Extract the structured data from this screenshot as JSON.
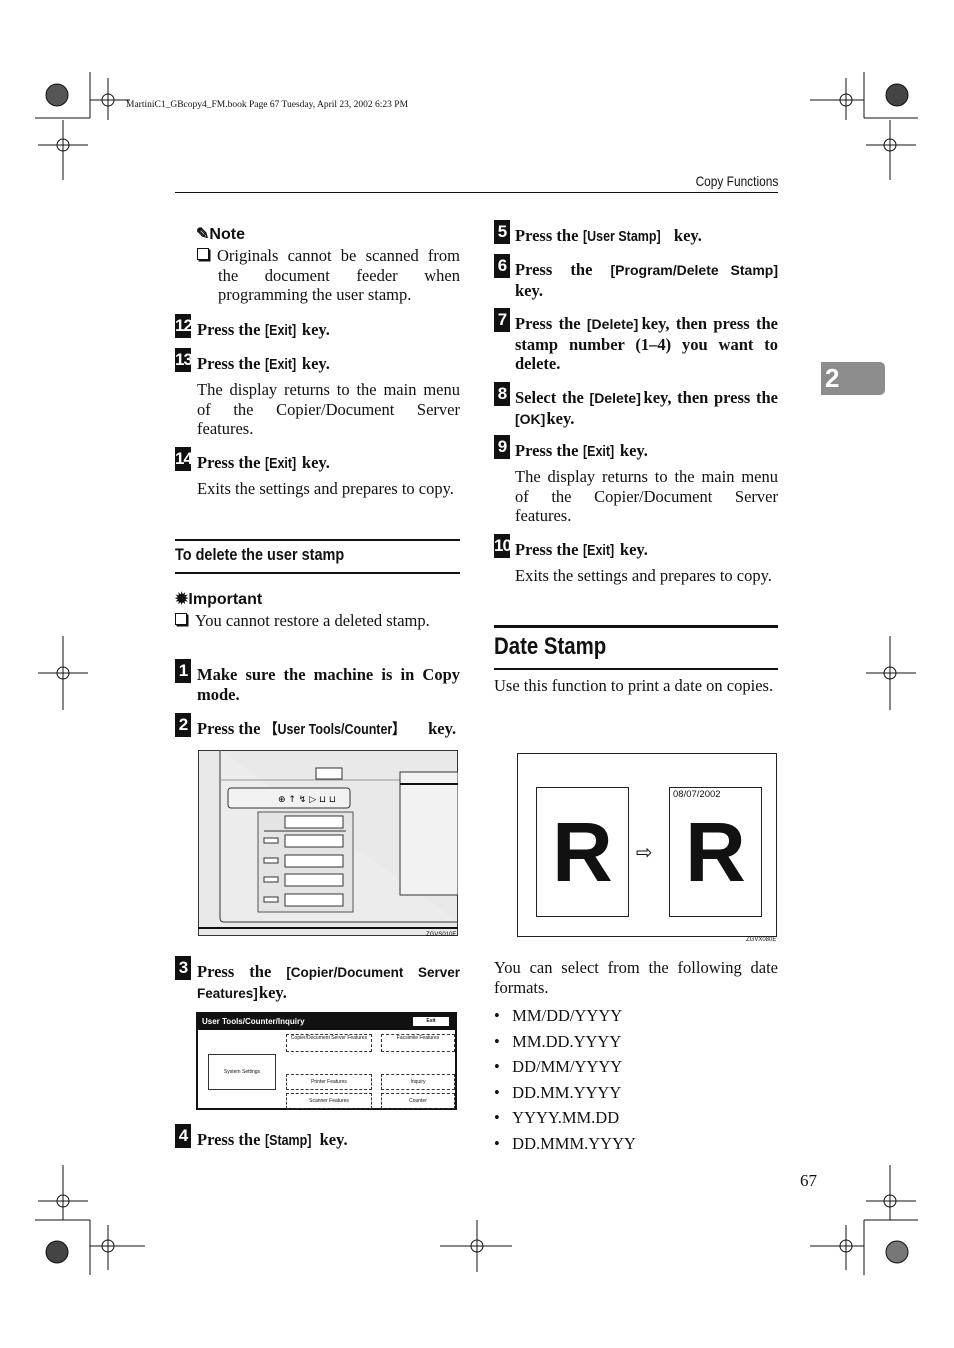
{
  "header": {
    "file_info": "MartiniC1_GBcopy4_FM.book  Page 67  Tuesday, April 23, 2002  6:23 PM",
    "section": "Copy Functions"
  },
  "chapter_tab": "2",
  "page_number": "67",
  "left": {
    "note": {
      "title": "Note",
      "text": "Originals cannot be scanned from the document feeder when programming the user stamp.",
      "icon": "pencil-icon"
    },
    "step12": {
      "num": "12",
      "pre": "Press the ",
      "key": "[Exit]",
      "post": " key."
    },
    "step13": {
      "num": "13",
      "pre": "Press the ",
      "key": "[Exit]",
      "post": " key.",
      "body": "The display returns to the main menu of the Copier/Document Server features."
    },
    "step14": {
      "num": "14",
      "pre": "Press the ",
      "key": "[Exit]",
      "post": " key.",
      "body": "Exits the settings and prepares to copy."
    },
    "subheading": "To delete the user stamp",
    "important": {
      "title": "Important",
      "text": "You cannot restore a deleted stamp.",
      "icon": "important-icon"
    },
    "step1": {
      "num": "1",
      "text": "Make sure the machine is in Copy mode."
    },
    "step2": {
      "num": "2",
      "pre": "Press the ",
      "key": "【User Tools/Counter】",
      "post": " key."
    },
    "panel_fig": {
      "caption": "ZGVS010E"
    },
    "step3": {
      "num": "3",
      "pre": "Press the ",
      "key": "[Copier/Document Server Features]",
      "post": " key."
    },
    "screen_fig": {
      "title": "User Tools/Counter/Inquiry",
      "exit": "Exit",
      "buttons": [
        "Copier/Document Server Features",
        "Facsimile Features",
        "System Settings",
        "Printer Features",
        "Inquiry",
        "Scanner Features",
        "Counter"
      ]
    },
    "step4": {
      "num": "4",
      "pre": "Press the ",
      "key": "[Stamp]",
      "post": " key."
    }
  },
  "right": {
    "step5": {
      "num": "5",
      "pre": "Press the ",
      "key": "[User Stamp]",
      "post": " key."
    },
    "step6": {
      "num": "6",
      "pre": "Press the ",
      "key": "[Program/Delete Stamp]",
      "post": " key."
    },
    "step7": {
      "num": "7",
      "pre": "Press the ",
      "key": "[Delete]",
      "post": " key, then press the stamp number (1–4) you want to delete."
    },
    "step8": {
      "num": "8",
      "pre": "Select the ",
      "key": "[Delete]",
      "mid": " key, then press the ",
      "key2": "[OK]",
      "post": " key."
    },
    "step9": {
      "num": "9",
      "pre": "Press the ",
      "key": "[Exit]",
      "post": " key.",
      "body": "The display returns to the main menu of the Copier/Document Server features."
    },
    "step10": {
      "num": "10",
      "pre": "Press the ",
      "key": "[Exit]",
      "post": " key.",
      "body": "Exits the settings and prepares to copy."
    },
    "heading": "Date Stamp",
    "intro": "Use this function to print a date on copies.",
    "date_fig": {
      "letter": "R",
      "stamp": "08/07/2002",
      "caption": "ZGVX080E"
    },
    "formats_intro": "You can select from the following date formats.",
    "formats": [
      "MM/DD/YYYY",
      "MM.DD.YYYY",
      "DD/MM/YYYY",
      "DD.MM.YYYY",
      "YYYY.MM.DD",
      "DD.MMM.YYYY"
    ]
  }
}
